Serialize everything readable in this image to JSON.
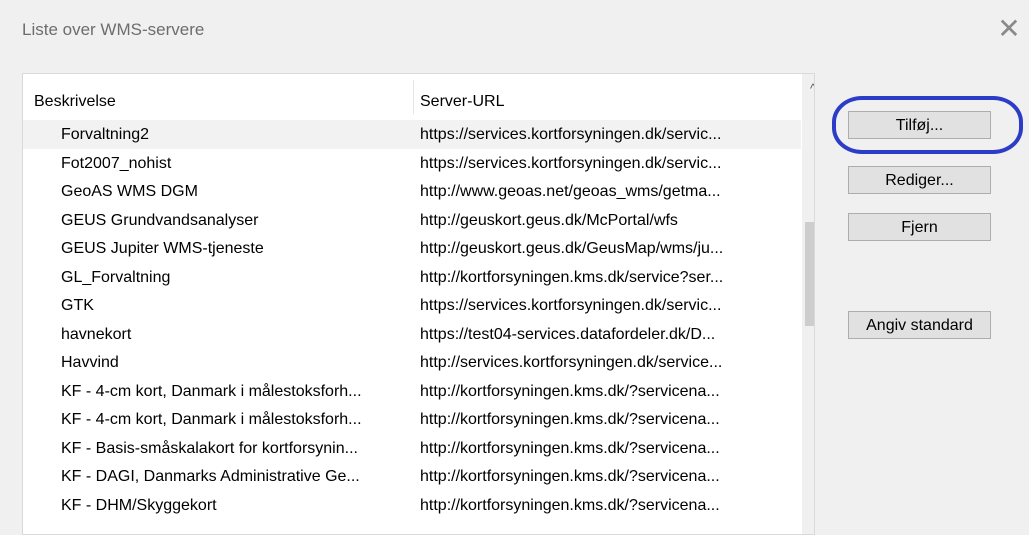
{
  "dialog": {
    "title": "Liste over WMS-servere",
    "close_glyph": "✕"
  },
  "table": {
    "columns": [
      "Beskrivelse",
      "Server-URL"
    ],
    "selected_index": 0,
    "rows": [
      {
        "description": "Forvaltning2",
        "url": "https://services.kortforsyningen.dk/servic..."
      },
      {
        "description": "Fot2007_nohist",
        "url": "https://services.kortforsyningen.dk/servic..."
      },
      {
        "description": "GeoAS WMS DGM",
        "url": "http://www.geoas.net/geoas_wms/getma..."
      },
      {
        "description": "GEUS Grundvandsanalyser",
        "url": "http://geuskort.geus.dk/McPortal/wfs"
      },
      {
        "description": "GEUS Jupiter WMS-tjeneste",
        "url": "http://geuskort.geus.dk/GeusMap/wms/ju..."
      },
      {
        "description": "GL_Forvaltning",
        "url": "http://kortforsyningen.kms.dk/service?ser..."
      },
      {
        "description": "GTK",
        "url": "https://services.kortforsyningen.dk/servic..."
      },
      {
        "description": "havnekort",
        "url": "https://test04-services.datafordeler.dk/D..."
      },
      {
        "description": "Havvind",
        "url": "http://services.kortforsyningen.dk/service..."
      },
      {
        "description": "KF - 4-cm kort, Danmark i målestoksforh...",
        "url": "http://kortforsyningen.kms.dk/?servicena..."
      },
      {
        "description": "KF - 4-cm kort, Danmark i målestoksforh...",
        "url": "http://kortforsyningen.kms.dk/?servicena..."
      },
      {
        "description": "KF - Basis-småskalakort for kortforsynin...",
        "url": "http://kortforsyningen.kms.dk/?servicena..."
      },
      {
        "description": "KF - DAGI, Danmarks Administrative Ge...",
        "url": "http://kortforsyningen.kms.dk/?servicena..."
      },
      {
        "description": "KF - DHM/Skyggekort",
        "url": "http://kortforsyningen.kms.dk/?servicena..."
      }
    ],
    "scrollbar_up_glyph": "^"
  },
  "buttons": {
    "add": "Tilføj...",
    "edit": "Rediger...",
    "remove": "Fjern",
    "set_default": "Angiv standard"
  },
  "colors": {
    "highlight_ring": "#2b3cc7",
    "selected_row": "#f2f2f2"
  }
}
